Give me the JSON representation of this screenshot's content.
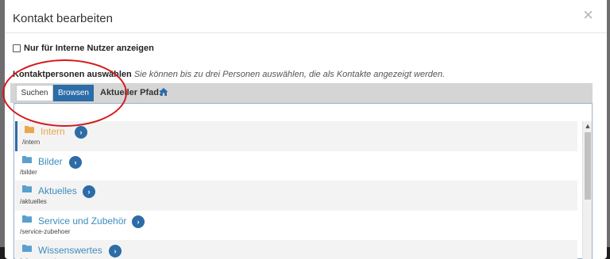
{
  "modal": {
    "title": "Kontakt bearbeiten",
    "close_glyph": "×"
  },
  "internal_only": {
    "label": "Nur für Interne Nutzer anzeigen",
    "checked": false
  },
  "contacts_hint": {
    "bold": "Kontaktpersonen auswählen",
    "italic": "Sie können bis zu drei Personen auswählen, die als Kontakte angezeigt werden."
  },
  "toolbar": {
    "search_label": "Suchen",
    "browse_label": "Browsen",
    "path_label": "Aktueller Pfad:",
    "home_icon": "home-icon"
  },
  "search": {
    "value": "",
    "placeholder": ""
  },
  "folders": [
    {
      "name": "Intern",
      "path": "/intern",
      "active": true
    },
    {
      "name": "Bilder",
      "path": "/bilder",
      "active": false
    },
    {
      "name": "Aktuelles",
      "path": "/aktuelles",
      "active": false
    },
    {
      "name": "Service und Zubehör",
      "path": "/service-zubehoer",
      "active": false
    },
    {
      "name": "Wissenswertes",
      "path": "/wissenswertes",
      "active": false
    }
  ],
  "arrow_glyph": "›",
  "scroll_up_glyph": "▲",
  "colors": {
    "accent": "#2c6ca7",
    "folder": "#e8a84c",
    "link": "#3c8dbc",
    "highlight_ring": "#d4191e"
  }
}
